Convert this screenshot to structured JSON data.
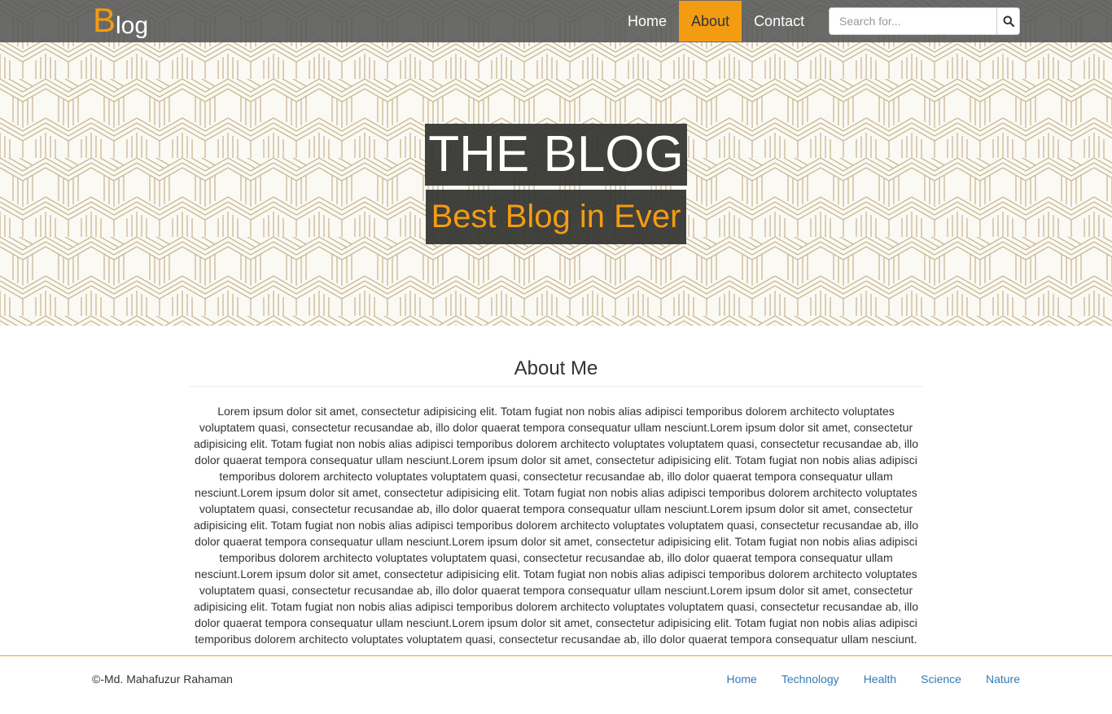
{
  "navbar": {
    "brand_initial": "B",
    "brand_rest": "log",
    "items": [
      {
        "label": "Home",
        "active": false
      },
      {
        "label": "About",
        "active": true
      },
      {
        "label": "Contact",
        "active": false
      }
    ],
    "search_placeholder": "Search for...",
    "search_icon": "search-icon"
  },
  "hero": {
    "title": "THE BLOG",
    "subtitle": "Best Blog in Ever"
  },
  "about": {
    "heading": "About Me",
    "body": "Lorem ipsum dolor sit amet, consectetur adipisicing elit. Totam fugiat non nobis alias adipisci temporibus dolorem architecto voluptates voluptatem quasi, consectetur recusandae ab, illo dolor quaerat tempora consequatur ullam nesciunt.Lorem ipsum dolor sit amet, consectetur adipisicing elit. Totam fugiat non nobis alias adipisci temporibus dolorem architecto voluptates voluptatem quasi, consectetur recusandae ab, illo dolor quaerat tempora consequatur ullam nesciunt.Lorem ipsum dolor sit amet, consectetur adipisicing elit. Totam fugiat non nobis alias adipisci temporibus dolorem architecto voluptates voluptatem quasi, consectetur recusandae ab, illo dolor quaerat tempora consequatur ullam nesciunt.Lorem ipsum dolor sit amet, consectetur adipisicing elit. Totam fugiat non nobis alias adipisci temporibus dolorem architecto voluptates voluptatem quasi, consectetur recusandae ab, illo dolor quaerat tempora consequatur ullam nesciunt.Lorem ipsum dolor sit amet, consectetur adipisicing elit. Totam fugiat non nobis alias adipisci temporibus dolorem architecto voluptates voluptatem quasi, consectetur recusandae ab, illo dolor quaerat tempora consequatur ullam nesciunt.Lorem ipsum dolor sit amet, consectetur adipisicing elit. Totam fugiat non nobis alias adipisci temporibus dolorem architecto voluptates voluptatem quasi, consectetur recusandae ab, illo dolor quaerat tempora consequatur ullam nesciunt.Lorem ipsum dolor sit amet, consectetur adipisicing elit. Totam fugiat non nobis alias adipisci temporibus dolorem architecto voluptates voluptatem quasi, consectetur recusandae ab, illo dolor quaerat tempora consequatur ullam nesciunt.Lorem ipsum dolor sit amet, consectetur adipisicing elit. Totam fugiat non nobis alias adipisci temporibus dolorem architecto voluptates voluptatem quasi, consectetur recusandae ab, illo dolor quaerat tempora consequatur ullam nesciunt.Lorem ipsum dolor sit amet, consectetur adipisicing elit. Totam fugiat non nobis alias adipisci temporibus dolorem architecto voluptates voluptatem quasi, consectetur recusandae ab, illo dolor quaerat tempora consequatur ullam nesciunt."
  },
  "footer": {
    "copyright": "©-Md. Mahafuzur Rahaman",
    "links": [
      "Home",
      "Technology",
      "Health",
      "Science",
      "Nature"
    ]
  },
  "colors": {
    "accent": "#f39c12",
    "navbar_bg": "#555555",
    "link": "#337ab7",
    "hero_pattern": "#c9b891"
  }
}
